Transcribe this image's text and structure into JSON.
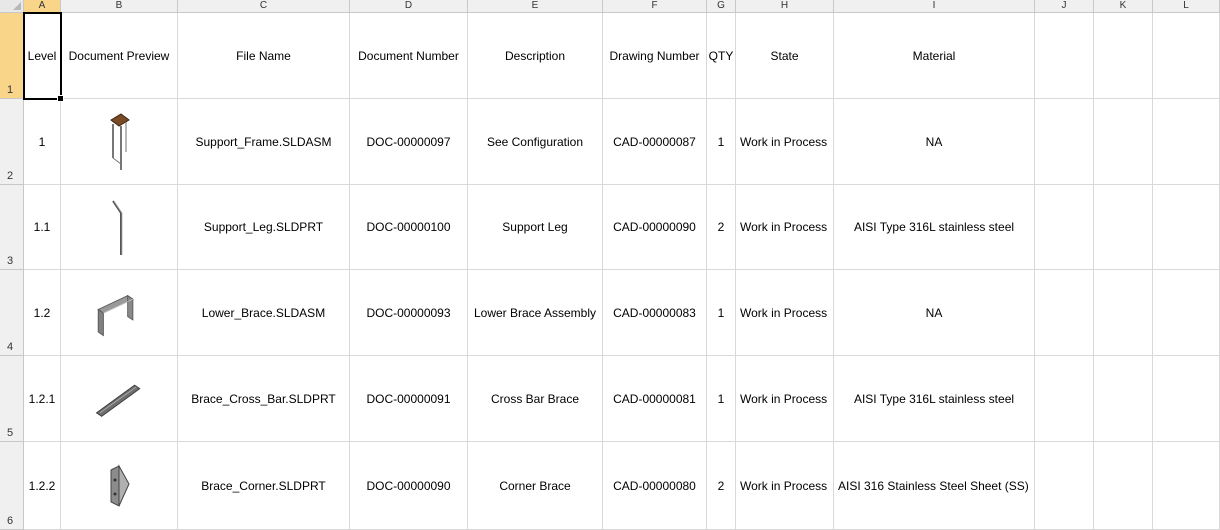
{
  "columns": [
    "A",
    "B",
    "C",
    "D",
    "E",
    "F",
    "G",
    "H",
    "I",
    "J",
    "K",
    "L"
  ],
  "row_numbers": [
    "1",
    "2",
    "3",
    "4",
    "5",
    "6"
  ],
  "headers": {
    "level": "Level",
    "preview": "Document Preview",
    "file_name": "File Name",
    "document_number": "Document Number",
    "description": "Description",
    "drawing_number": "Drawing Number",
    "qty": "QTY",
    "state": "State",
    "material": "Material"
  },
  "rows": [
    {
      "level": "1",
      "preview_icon": "support-frame-thumbnail",
      "file_name": "Support_Frame.SLDASM",
      "document_number": "DOC-00000097",
      "description": "See Configuration",
      "drawing_number": "CAD-00000087",
      "qty": "1",
      "state": "Work in Process",
      "material": "NA"
    },
    {
      "level": "1.1",
      "preview_icon": "support-leg-thumbnail",
      "file_name": "Support_Leg.SLDPRT",
      "document_number": "DOC-00000100",
      "description": "Support Leg",
      "drawing_number": "CAD-00000090",
      "qty": "2",
      "state": "Work in Process",
      "material": "AISI Type 316L stainless steel"
    },
    {
      "level": "1.2",
      "preview_icon": "lower-brace-thumbnail",
      "file_name": "Lower_Brace.SLDASM",
      "document_number": "DOC-00000093",
      "description": "Lower Brace Assembly",
      "drawing_number": "CAD-00000083",
      "qty": "1",
      "state": "Work in Process",
      "material": "NA"
    },
    {
      "level": "1.2.1",
      "preview_icon": "cross-bar-thumbnail",
      "file_name": "Brace_Cross_Bar.SLDPRT",
      "document_number": "DOC-00000091",
      "description": "Cross Bar Brace",
      "drawing_number": "CAD-00000081",
      "qty": "1",
      "state": "Work in Process",
      "material": "AISI Type 316L stainless steel"
    },
    {
      "level": "1.2.2",
      "preview_icon": "corner-brace-thumbnail",
      "file_name": "Brace_Corner.SLDPRT",
      "document_number": "DOC-00000090",
      "description": "Corner Brace",
      "drawing_number": "CAD-00000080",
      "qty": "2",
      "state": "Work in Process",
      "material": "AISI 316 Stainless Steel Sheet (SS)"
    }
  ],
  "colors": {
    "header_selected": "#f9d58a",
    "header_bg": "#f0f0f0",
    "gridline": "#d9d9d9"
  }
}
